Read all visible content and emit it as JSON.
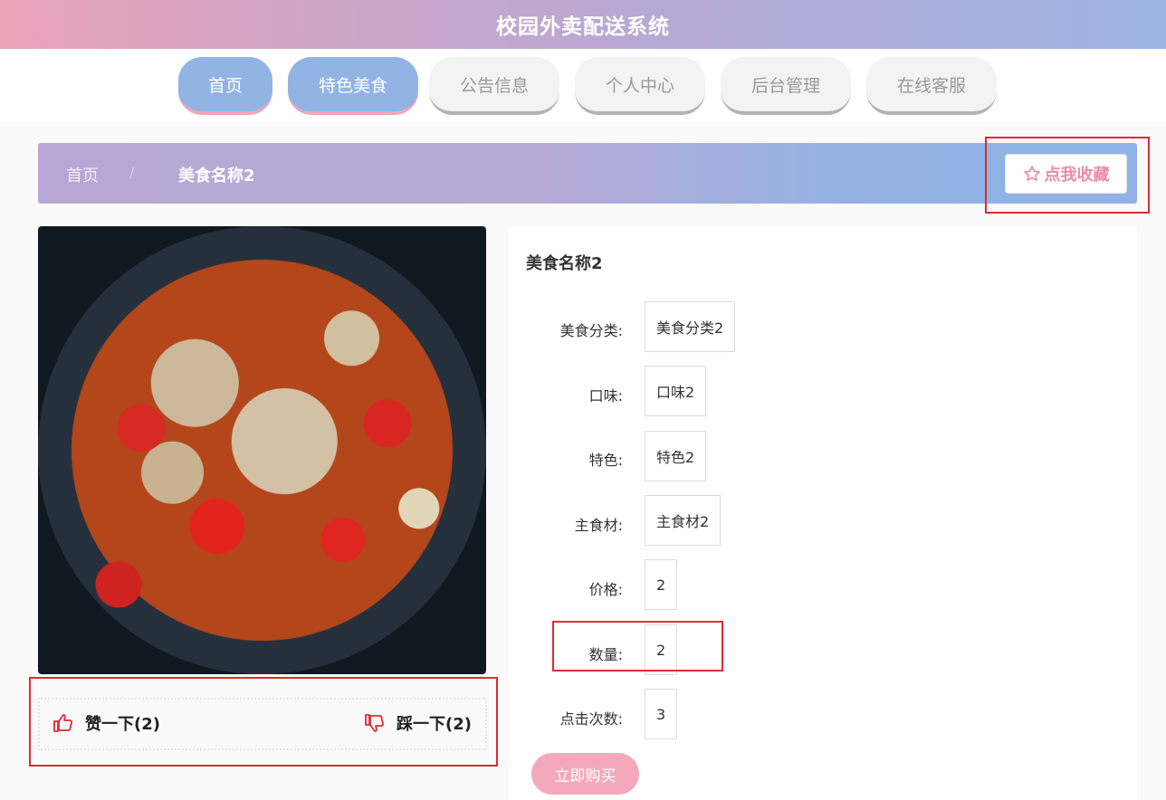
{
  "header": {
    "title": "校园外卖配送系统"
  },
  "nav": {
    "items": [
      {
        "label": "首页",
        "active": true
      },
      {
        "label": "特色美食",
        "active": true
      },
      {
        "label": "公告信息",
        "active": false
      },
      {
        "label": "个人中心",
        "active": false
      },
      {
        "label": "后台管理",
        "active": false
      },
      {
        "label": "在线客服",
        "active": false
      }
    ]
  },
  "breadcrumb": {
    "home": "首页",
    "separator": "/",
    "current": "美食名称2"
  },
  "favorite": {
    "label": "点我收藏",
    "icon": "star-outline-icon"
  },
  "food": {
    "image_alt": "spicy frog pot with red peppers",
    "like_label": "赞一下(2)",
    "dislike_label": "踩一下(2)",
    "name": "美食名称2",
    "fields": [
      {
        "label": "美食分类:",
        "value": "美食分类2"
      },
      {
        "label": "口味:",
        "value": "口味2"
      },
      {
        "label": "特色:",
        "value": "特色2"
      },
      {
        "label": "主食材:",
        "value": "主食材2"
      },
      {
        "label": "价格:",
        "value": "2"
      },
      {
        "label": "数量:",
        "value": "2"
      },
      {
        "label": "点击次数:",
        "value": "3"
      }
    ],
    "buy_label": "立即购买"
  },
  "colors": {
    "accent_pink": "#f4a9bb",
    "accent_blue": "#92b4e5",
    "highlight_red": "#e02a33"
  }
}
